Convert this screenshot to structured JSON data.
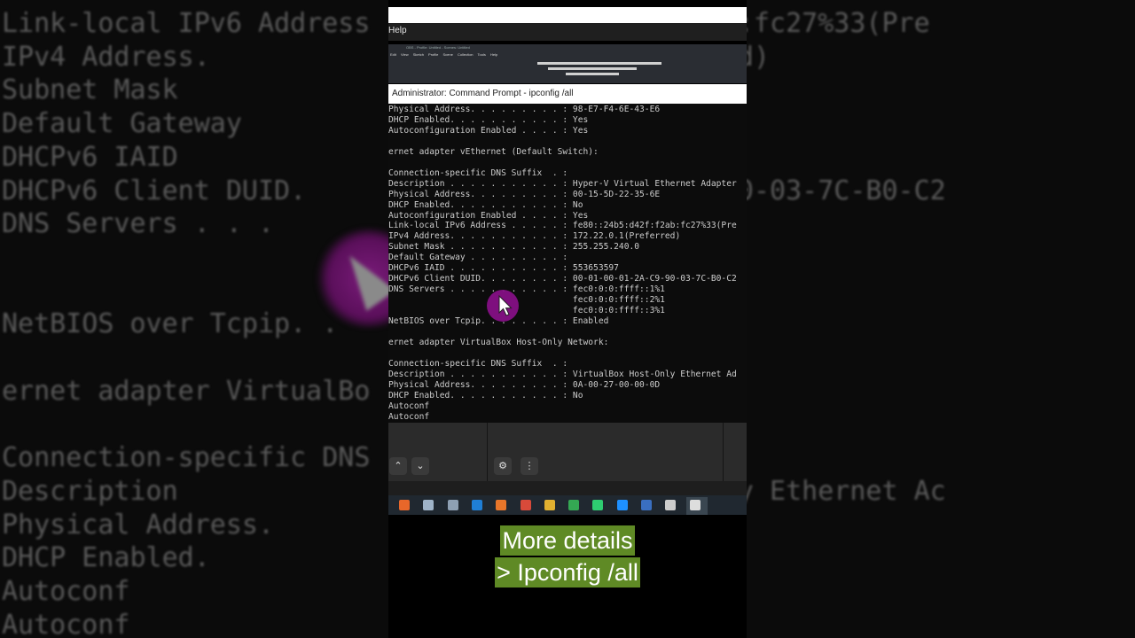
{
  "background": {
    "lines": [
      "Link-local IPv6 Address",
      "IPv4 Address.",
      "Subnet Mask",
      "Default Gateway",
      "DHCPv6 IAID",
      "DHCPv6 Client DUID.",
      "DNS Servers . . .",
      "",
      "",
      "NetBIOS over Tcpip. .",
      "",
      "ernet adapter VirtualBo",
      "",
      "Connection-specific DNS",
      "Description",
      "Physical Address.",
      "DHCP Enabled.",
      "Autoconf",
      "Autoconf"
    ],
    "right_lines": [
      "                    5:d42f:f2ab:fc27%33(Pre",
      "                    .1(Preferred)",
      "                    240.0",
      "",
      "                    7",
      "                    -01-2A-C9-90-03-7C-B0-C2",
      "                    ffff::1%1",
      "                    :ffff::2%1",
      "                    :ffff::3%1",
      "",
      "",
      "",
      "",
      "",
      "                    ox Host-Only Ethernet Ac",
      "                    -00-00-0D"
    ]
  },
  "window": {
    "help_label": "Help",
    "title": "Administrator: Command Prompt - ipconfig /all",
    "app_menu": "Edit View Sketch Profile Scene Collection Tools Help",
    "app_title": "OBS - Profile: Untitled - Scenes: Untitled"
  },
  "console": {
    "text": "Physical Address. . . . . . . . . : 98-E7-F4-6E-43-E6\nDHCP Enabled. . . . . . . . . . . : Yes\nAutoconfiguration Enabled . . . . : Yes\n\nernet adapter vEthernet (Default Switch):\n\nConnection-specific DNS Suffix  . :\nDescription . . . . . . . . . . . : Hyper-V Virtual Ethernet Adapter\nPhysical Address. . . . . . . . . : 00-15-5D-22-35-6E\nDHCP Enabled. . . . . . . . . . . : No\nAutoconfiguration Enabled . . . . : Yes\nLink-local IPv6 Address . . . . . : fe80::24b5:d42f:f2ab:fc27%33(Pre\nIPv4 Address. . . . . . . . . . . : 172.22.0.1(Preferred)\nSubnet Mask . . . . . . . . . . . : 255.255.240.0\nDefault Gateway . . . . . . . . . :\nDHCPv6 IAID . . . . . . . . . . . : 553653597\nDHCPv6 Client DUID. . . . . . . . : 00-01-00-01-2A-C9-90-03-7C-B0-C2\nDNS Servers . . . . . . . . . . . : fec0:0:0:ffff::1%1\n                                    fec0:0:0:ffff::2%1\n                                    fec0:0:0:ffff::3%1\nNetBIOS over Tcpip. . . . . . . . : Enabled\n\nernet adapter VirtualBox Host-Only Network:\n\nConnection-specific DNS Suffix  . :\nDescription . . . . . . . . . . . : VirtualBox Host-Only Ethernet Ad\nPhysical Address. . . . . . . . . : 0A-00-27-00-00-0D\nDHCP Enabled. . . . . . . . . . . : No\nAutoconf\nAutoconf"
  },
  "panel": {
    "up_glyph": "⌃",
    "down_glyph": "⌄",
    "gear_glyph": "⚙",
    "more_glyph": "⋮"
  },
  "taskbar": {
    "icon_colors": [
      "#e8672a",
      "#9fb3c8",
      "#8ea0b3",
      "#1f7fd6",
      "#e8762a",
      "#d84a3a",
      "#e0b030",
      "#34a853",
      "#2ecc71",
      "#1e90ff",
      "#3a6fc0",
      "#cccccc",
      "#dddddd"
    ]
  },
  "caption": {
    "line1": "More details",
    "line2": "> Ipconfig /all"
  },
  "colors": {
    "caption_bg": "#5f8a25",
    "cursor_highlight": "#8b0f8b",
    "console_text": "#cccccc"
  }
}
